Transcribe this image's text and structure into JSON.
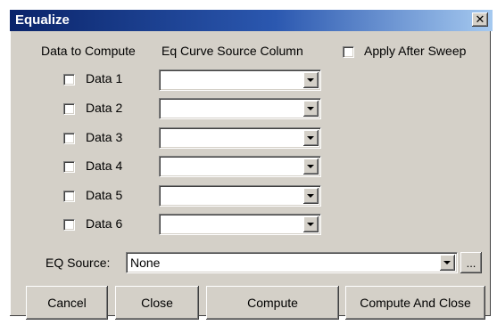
{
  "window": {
    "title": "Equalize",
    "close_glyph": "✕"
  },
  "headers": {
    "data_to_compute": "Data to Compute",
    "eq_curve_source": "Eq Curve Source Column",
    "apply_after_sweep": "Apply After Sweep"
  },
  "data_rows": [
    {
      "label": "Data 1",
      "checked": false,
      "source": ""
    },
    {
      "label": "Data 2",
      "checked": false,
      "source": ""
    },
    {
      "label": "Data 3",
      "checked": false,
      "source": ""
    },
    {
      "label": "Data 4",
      "checked": false,
      "source": ""
    },
    {
      "label": "Data 5",
      "checked": false,
      "source": ""
    },
    {
      "label": "Data 6",
      "checked": false,
      "source": ""
    }
  ],
  "eq_source": {
    "label": "EQ Source:",
    "value": "None",
    "browse_label": "..."
  },
  "buttons": {
    "cancel": "Cancel",
    "close": "Close",
    "compute": "Compute",
    "compute_and_close": "Compute And Close"
  },
  "icons": {
    "dropdown": "chevron-down-icon",
    "close": "close-icon"
  }
}
